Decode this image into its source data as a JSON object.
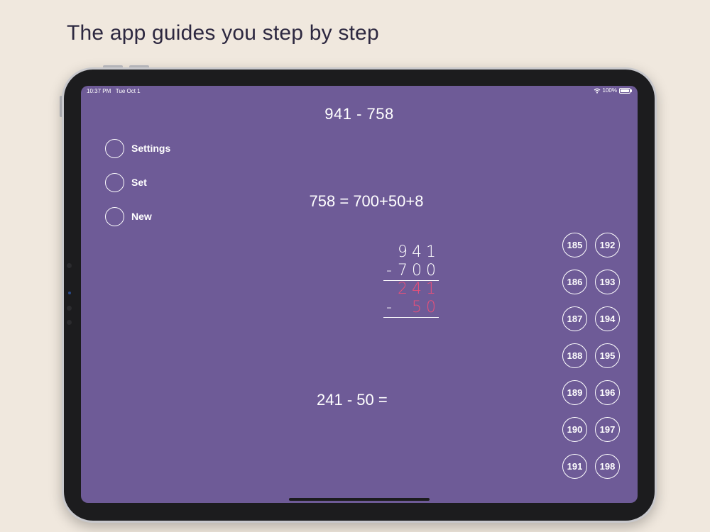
{
  "headline": "The app guides you step by step",
  "status_bar": {
    "time": "10:37 PM",
    "date": "Tue Oct 1",
    "battery": "100%",
    "wifi_icon": "wifi-icon",
    "battery_icon": "battery-icon"
  },
  "problem": "941 - 758",
  "menu": [
    {
      "label": "Settings"
    },
    {
      "label": "Set"
    },
    {
      "label": "New"
    }
  ],
  "decomposition": "758 = 700+50+8",
  "column": {
    "row1": "941",
    "row2_sign": "-",
    "row2": "700",
    "row3": "241",
    "row4_sign": "-",
    "row4": "50",
    "highlight_color": "#e9507a"
  },
  "equation": "241 - 50 =",
  "answers": [
    "185",
    "192",
    "186",
    "193",
    "187",
    "194",
    "188",
    "195",
    "189",
    "196",
    "190",
    "197",
    "191",
    "198"
  ],
  "colors": {
    "background": "#f0e8de",
    "screen": "#6e5b97",
    "highlight": "#e9507a"
  }
}
